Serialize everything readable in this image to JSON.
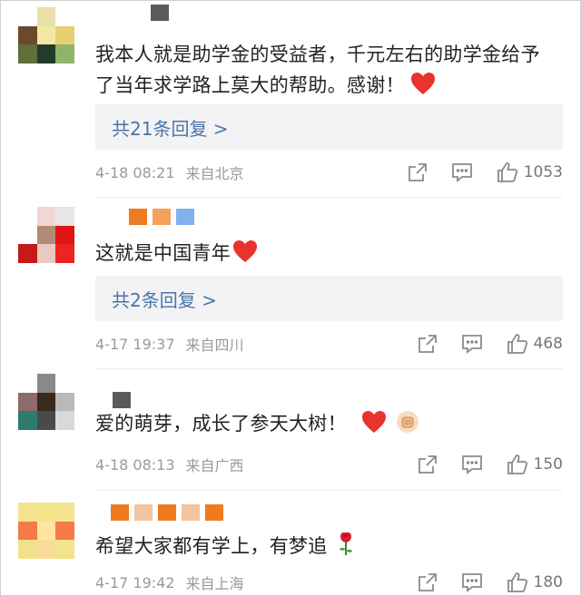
{
  "comments": [
    {
      "text": "我本人就是助学金的受益者，千元左右的助学金给予了当年求学路上莫大的帮助。感谢！",
      "emoji": "heart",
      "replies": "共21条回复 >",
      "time": "4-18 08:21",
      "location": "来自北京",
      "likes": "1053",
      "avatar_colors": [
        "#ffffff",
        "#e9dfa8",
        "#ffffff",
        "#6a4a2a",
        "#f3e7a4",
        "#e8d070",
        "#5f6e3a",
        "#233b2a",
        "#8fb56a"
      ],
      "name_colors": [
        "#ffffff",
        "#5a5a5a"
      ]
    },
    {
      "text": "这就是中国青年",
      "emoji": "heart",
      "replies": "共2条回复 >",
      "time": "4-17 19:37",
      "location": "来自四川",
      "likes": "468",
      "avatar_colors": [
        "#ffffff",
        "#f2d6d6",
        "#e6e6e6",
        "#ffffff",
        "#b38a75",
        "#e01414",
        "#c41a1a",
        "#e9c9c2",
        "#ee2222"
      ],
      "name_colors": [
        "#f07a1e",
        "#f4a25a",
        "#7fb2ee"
      ]
    },
    {
      "text": "爱的萌芽，成长了参天大树！",
      "emoji": "heart-fist",
      "replies": "",
      "time": "4-18 08:13",
      "location": "来自广西",
      "likes": "150",
      "avatar_colors": [
        "#ffffff",
        "#8a8a8a",
        "#ffffff",
        "#8f6a6a",
        "#3a2a1e",
        "#b9b9b9",
        "#2f7a6e",
        "#4a4a4a",
        "#d9d9d9"
      ],
      "name_colors": [
        "#5a5a5a"
      ]
    },
    {
      "text": "希望大家都有学上，有梦追",
      "emoji": "rose",
      "replies": "",
      "time": "4-17 19:42",
      "location": "来自上海",
      "likes": "180",
      "avatar_colors": [
        "#f4e48c",
        "#f3e488",
        "#f4e490",
        "#f57a45",
        "#ffe6a0",
        "#f57a45",
        "#f2e28c",
        "#f9dc9a",
        "#f2e48c"
      ],
      "name_colors": [
        "#f07a1e",
        "#f4c3a0",
        "#f07a1e",
        "#f4c3a0",
        "#f07a1e"
      ]
    }
  ]
}
